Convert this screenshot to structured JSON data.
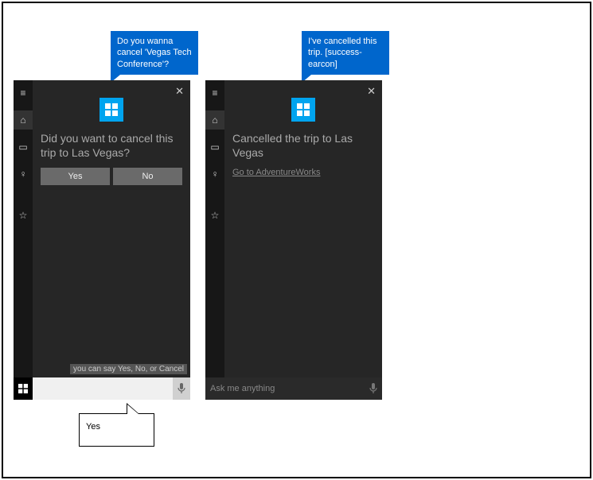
{
  "bubbles": {
    "left_blue": "Do you wanna cancel 'Vegas Tech Conference'?",
    "right_blue": "I've cancelled this trip. [success-earcon]",
    "white_input": "Yes"
  },
  "panel1": {
    "prompt": "Did you want to cancel this trip to Las Vegas?",
    "yes": "Yes",
    "no": "No",
    "hint": "you can say Yes, No, or Cancel",
    "search_placeholder": ""
  },
  "panel2": {
    "prompt": "Cancelled the trip to Las Vegas",
    "link": "Go to AdventureWorks",
    "search_placeholder": "Ask me anything"
  }
}
